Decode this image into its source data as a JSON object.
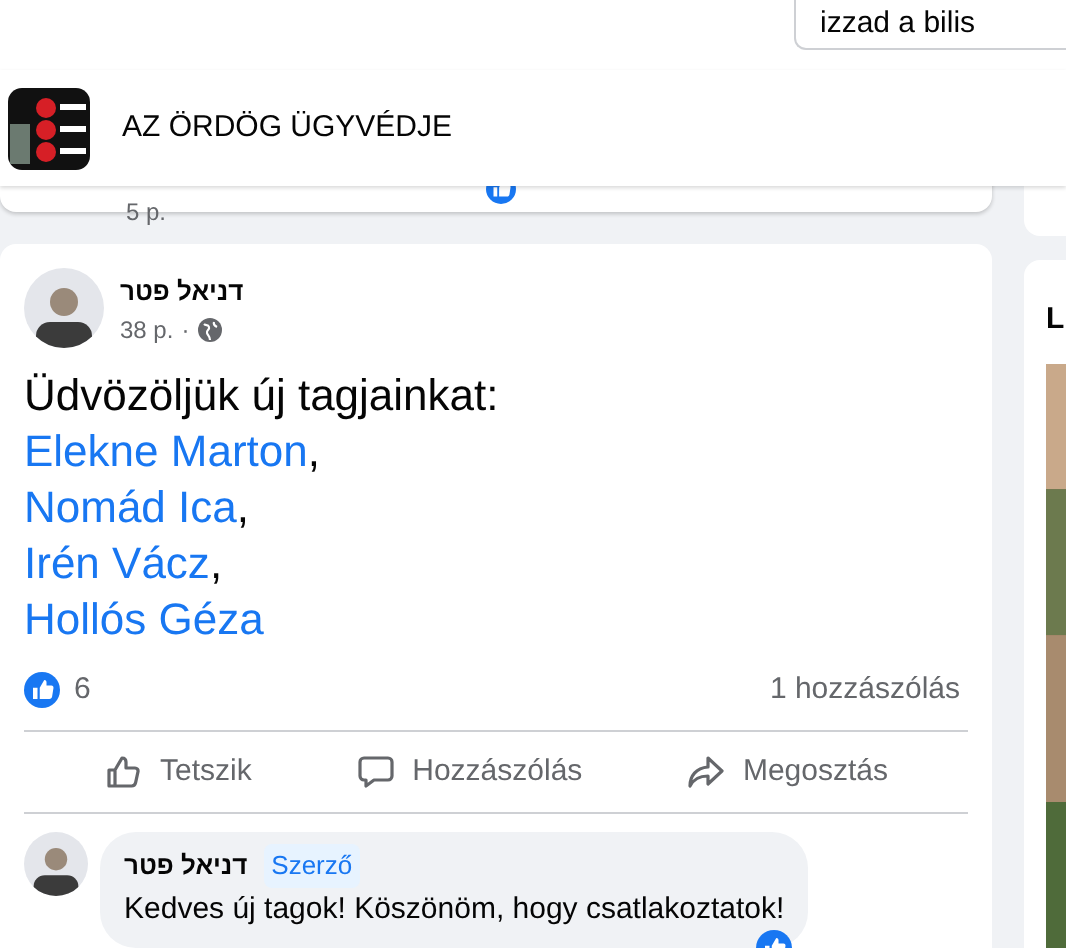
{
  "search": {
    "value": "izzad a bilis"
  },
  "group_header": {
    "name": "AZ ÖRDÖG ÜGYVÉDJE"
  },
  "previous_post": {
    "time": "5 p."
  },
  "post": {
    "author": "דניאל פטר",
    "time": "38 p.",
    "time_separator": "·",
    "intro": "Üdvözöljük új tagjainkat:",
    "members": [
      {
        "name": "Elekne Marton",
        "separator": ","
      },
      {
        "name": "Nomád Ica",
        "separator": ","
      },
      {
        "name": "Irén Vácz",
        "separator": ","
      },
      {
        "name": "Hollós Géza"
      }
    ],
    "like_count": "6",
    "comment_count": "1 hozzászólás",
    "actions": [
      {
        "kind": "like",
        "label": "Tetszik"
      },
      {
        "kind": "comment",
        "label": "Hozzászólás"
      },
      {
        "kind": "share",
        "label": "Megosztás"
      }
    ],
    "comment": {
      "author": "דניאל פטר",
      "badge": "Szerző",
      "text": "Kedves új tagok! Köszönöm, hogy csatlakoztatok!"
    }
  },
  "side_card": {
    "title": "L"
  }
}
